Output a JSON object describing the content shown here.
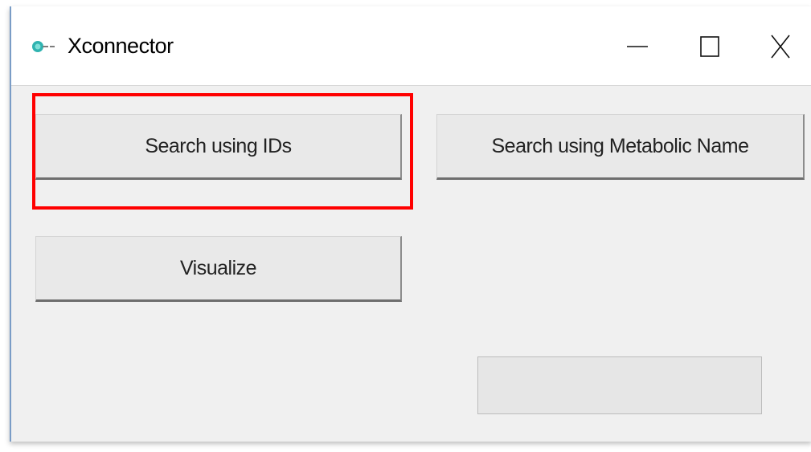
{
  "window": {
    "title": "Xconnector",
    "icon": "xconnector-app-icon",
    "controls": {
      "minimize_icon": "minimize-icon",
      "maximize_icon": "maximize-icon",
      "close_icon": "close-icon"
    }
  },
  "buttons": {
    "search_ids_label": "Search using IDs",
    "search_name_label": "Search using Metabolic Name",
    "visualize_label": "Visualize"
  },
  "progress": {
    "value": 0
  },
  "annotation": {
    "highlight_color": "#ff0000",
    "highlighted": "search-ids-button"
  },
  "colors": {
    "window_bg": "#f0f0f0",
    "titlebar_bg": "#ffffff",
    "button_bg": "#e9e9e9",
    "progress_track": "#e6e6e6"
  }
}
